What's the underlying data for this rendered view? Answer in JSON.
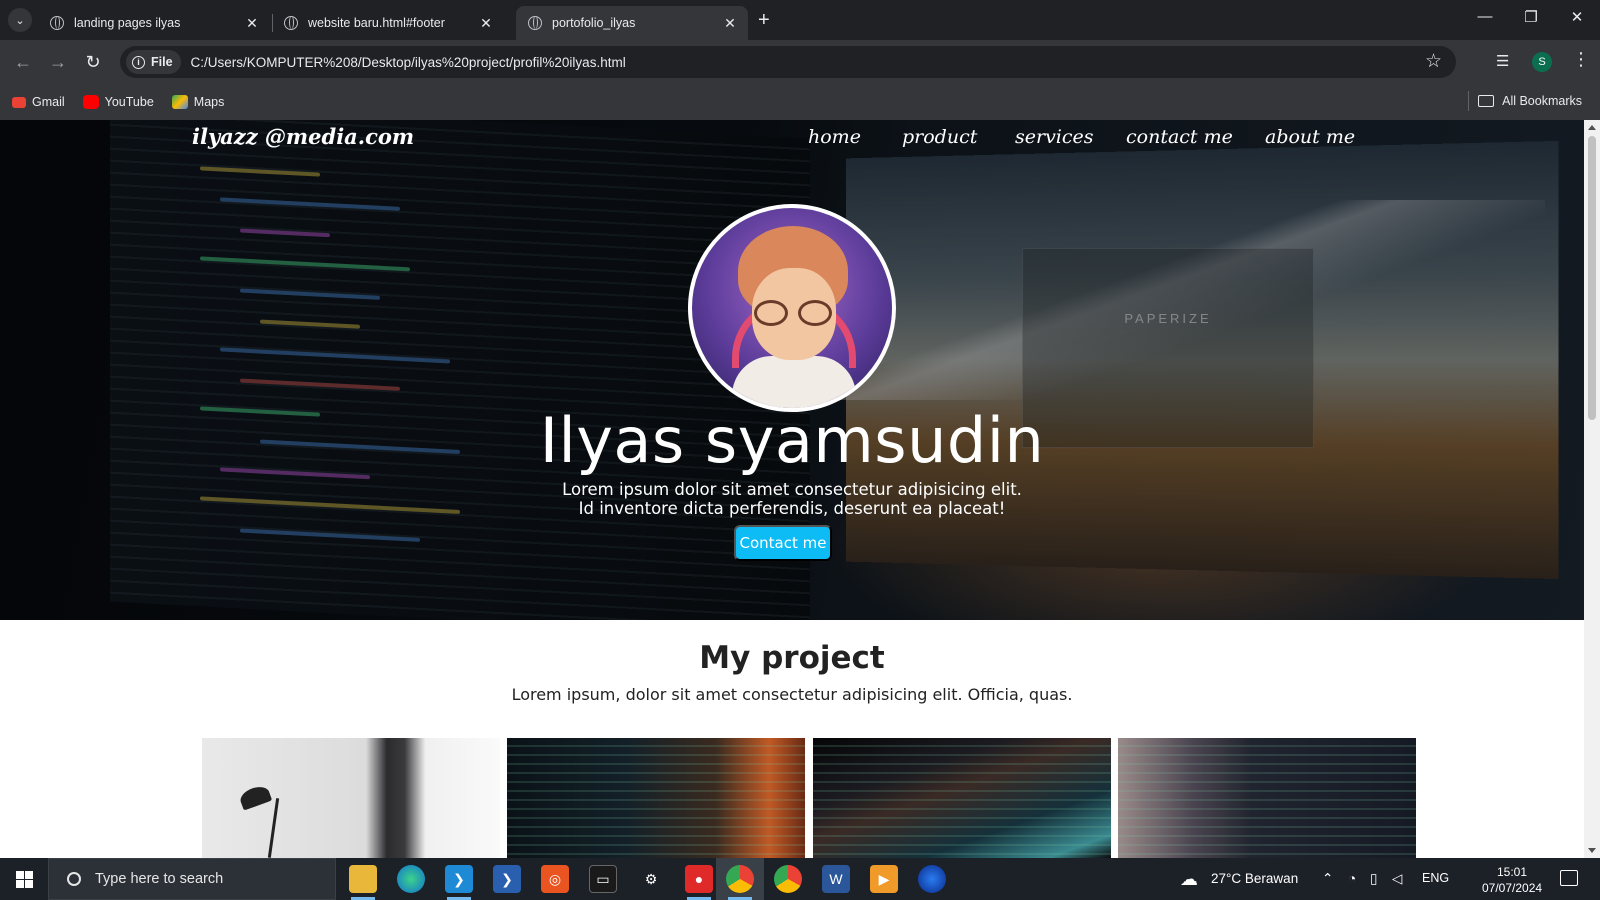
{
  "browser": {
    "tabs": [
      {
        "label": "landing pages ilyas",
        "active": false
      },
      {
        "label": "website baru.html#footer",
        "active": false
      },
      {
        "label": "portofolio_ilyas",
        "active": true
      }
    ],
    "chip_label": "File",
    "url": "C:/Users/KOMPUTER%208/Desktop/ilyas%20project/profil%20ilyas.html",
    "profile_initial": "S",
    "bookmarks": [
      {
        "label": "Gmail",
        "icon": "gmail-icon",
        "color": "#ea4335"
      },
      {
        "label": "YouTube",
        "icon": "youtube-icon",
        "color": "#ff0000"
      },
      {
        "label": "Maps",
        "icon": "maps-icon",
        "color": "#34a853"
      }
    ],
    "all_bookmarks": "All Bookmarks"
  },
  "page": {
    "brand": "ilyazz @media.com",
    "nav": [
      "home",
      "product",
      "services",
      "contact me",
      "about me"
    ],
    "hero": {
      "name": "Ilyas syamsudin",
      "line1": "Lorem ipsum dolor sit amet consectetur adipisicing elit.",
      "line2": "Id inventore dicta perferendis, deserunt ea placeat!",
      "button": "Contact me",
      "screen_text": "PAPERIZE"
    },
    "project": {
      "title": "My project",
      "subtitle": "Lorem ipsum, dolor sit amet consectetur adipisicing elit. Officia, quas."
    },
    "colors": {
      "accent": "#0dbbf5"
    }
  },
  "taskbar": {
    "search_placeholder": "Type here to search",
    "weather": "27°C  Berawan",
    "lang": "ENG",
    "time": "15:01",
    "date": "07/07/2024",
    "apps": [
      "file-explorer-icon",
      "edge-icon",
      "vscode-icon",
      "powershell-icon",
      "ubuntu-icon",
      "terminal-icon",
      "settings-icon",
      "screen-recorder-icon",
      "chrome-icon",
      "chrome-alt-icon",
      "word-icon",
      "media-player-icon",
      "browser-icon"
    ]
  }
}
